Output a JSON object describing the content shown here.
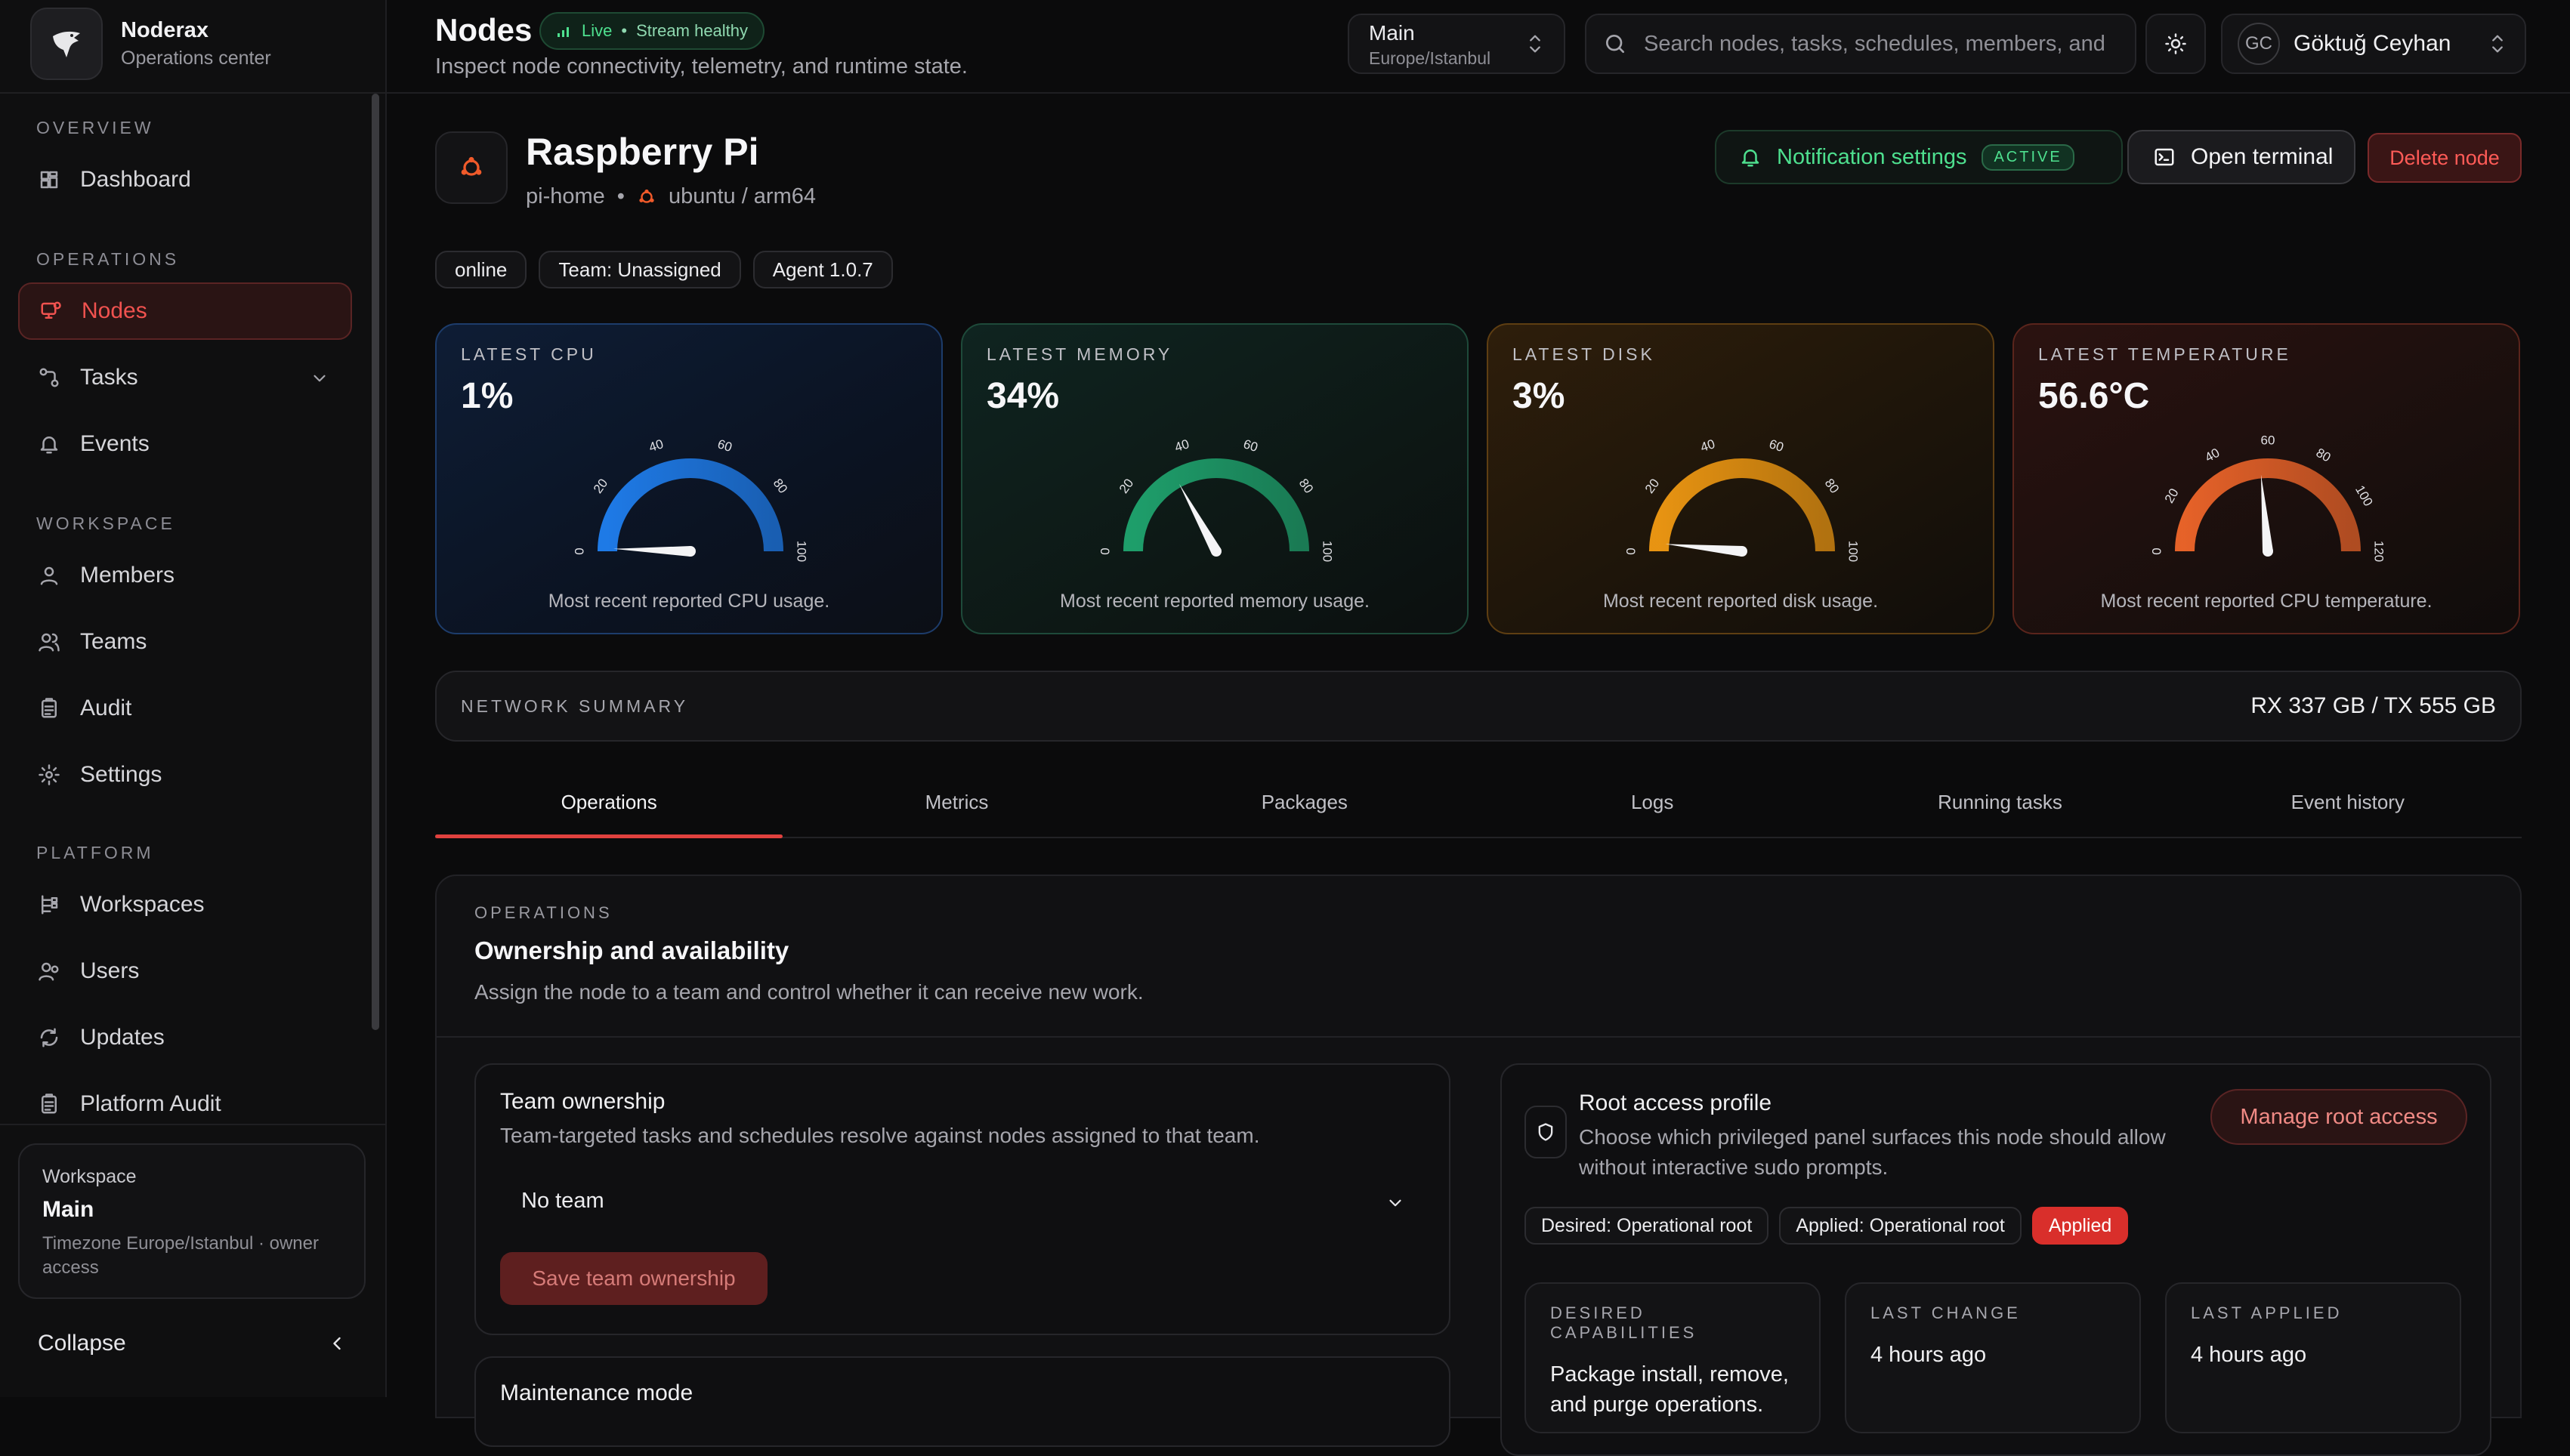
{
  "brand": {
    "name": "Noderax",
    "subtitle": "Operations center"
  },
  "sidebar": {
    "sections": [
      {
        "label": "OVERVIEW",
        "items": [
          {
            "label": "Dashboard",
            "icon": "dashboard-icon"
          }
        ]
      },
      {
        "label": "OPERATIONS",
        "items": [
          {
            "label": "Nodes",
            "icon": "nodes-icon",
            "active": true
          },
          {
            "label": "Tasks",
            "icon": "tasks-icon",
            "expandable": true
          },
          {
            "label": "Events",
            "icon": "bell-icon"
          }
        ]
      },
      {
        "label": "WORKSPACE",
        "items": [
          {
            "label": "Members",
            "icon": "user-icon"
          },
          {
            "label": "Teams",
            "icon": "users-icon"
          },
          {
            "label": "Audit",
            "icon": "clipboard-icon"
          },
          {
            "label": "Settings",
            "icon": "gear-icon"
          }
        ]
      },
      {
        "label": "PLATFORM",
        "items": [
          {
            "label": "Workspaces",
            "icon": "workspaces-icon"
          },
          {
            "label": "Users",
            "icon": "user-group-icon"
          },
          {
            "label": "Updates",
            "icon": "refresh-icon"
          },
          {
            "label": "Platform Audit",
            "icon": "clipboard-icon"
          }
        ]
      }
    ],
    "workspace_card": {
      "label": "Workspace",
      "name": "Main",
      "detail": "Timezone Europe/Istanbul · owner access"
    },
    "collapse_label": "Collapse"
  },
  "header": {
    "title": "Nodes",
    "live_label": "Live",
    "stream_label": "Stream healthy",
    "subtitle": "Inspect node connectivity, telemetry, and runtime state.",
    "workspace_select": {
      "name": "Main",
      "timezone": "Europe/Istanbul"
    },
    "search_placeholder": "Search nodes, tasks, schedules, members, and",
    "user": {
      "initials": "GC",
      "name": "Göktuğ Ceyhan"
    }
  },
  "node": {
    "name": "Raspberry Pi",
    "hostname": "pi-home",
    "os": "ubuntu / arm64",
    "chips": [
      "online",
      "Team: Unassigned",
      "Agent 1.0.7"
    ],
    "actions": {
      "notify_label": "Notification settings",
      "notify_badge": "ACTIVE",
      "terminal_label": "Open terminal",
      "delete_label": "Delete node"
    }
  },
  "metrics": [
    {
      "key": "cpu",
      "label": "LATEST CPU",
      "value": "1%",
      "fraction": 0.01,
      "ticks": [
        "0",
        "20",
        "40",
        "60",
        "80",
        "100"
      ],
      "max": 100,
      "note": "Most recent reported CPU usage.",
      "color": "#1f7ff0"
    },
    {
      "key": "mem",
      "label": "LATEST MEMORY",
      "value": "34%",
      "fraction": 0.34,
      "ticks": [
        "0",
        "20",
        "40",
        "60",
        "80",
        "100"
      ],
      "max": 100,
      "note": "Most recent reported memory usage.",
      "color": "#1fa56f"
    },
    {
      "key": "disk",
      "label": "LATEST DISK",
      "value": "3%",
      "fraction": 0.03,
      "ticks": [
        "0",
        "20",
        "40",
        "60",
        "80",
        "100"
      ],
      "max": 100,
      "note": "Most recent reported disk usage.",
      "color": "#f29a12"
    },
    {
      "key": "temp",
      "label": "LATEST TEMPERATURE",
      "value": "56.6°C",
      "fraction": 0.4717,
      "ticks": [
        "0",
        "20",
        "40",
        "60",
        "80",
        "100",
        "120"
      ],
      "max": 120,
      "note": "Most recent reported CPU temperature.",
      "color": "#f0662a"
    }
  ],
  "network": {
    "label": "NETWORK SUMMARY",
    "value": "RX 337 GB / TX 555 GB"
  },
  "tabs": [
    "Operations",
    "Metrics",
    "Packages",
    "Logs",
    "Running tasks",
    "Event history"
  ],
  "panel": {
    "eyebrow": "OPERATIONS",
    "title": "Ownership and availability",
    "description": "Assign the node to a team and control whether it can receive new work.",
    "team": {
      "title": "Team ownership",
      "description": "Team-targeted tasks and schedules resolve against nodes assigned to that team.",
      "selected": "No team",
      "save_label": "Save team ownership"
    },
    "maintenance": {
      "title": "Maintenance mode"
    },
    "root": {
      "title": "Root access profile",
      "description": "Choose which privileged panel surfaces this node should allow without interactive sudo prompts.",
      "manage_label": "Manage root access",
      "chips": [
        "Desired: Operational root",
        "Applied: Operational root",
        "Applied"
      ],
      "cards": [
        {
          "key": "DESIRED CAPABILITIES",
          "value": "Package install, remove, and purge operations."
        },
        {
          "key": "LAST CHANGE",
          "value": "4 hours ago"
        },
        {
          "key": "LAST APPLIED",
          "value": "4 hours ago"
        }
      ]
    }
  }
}
